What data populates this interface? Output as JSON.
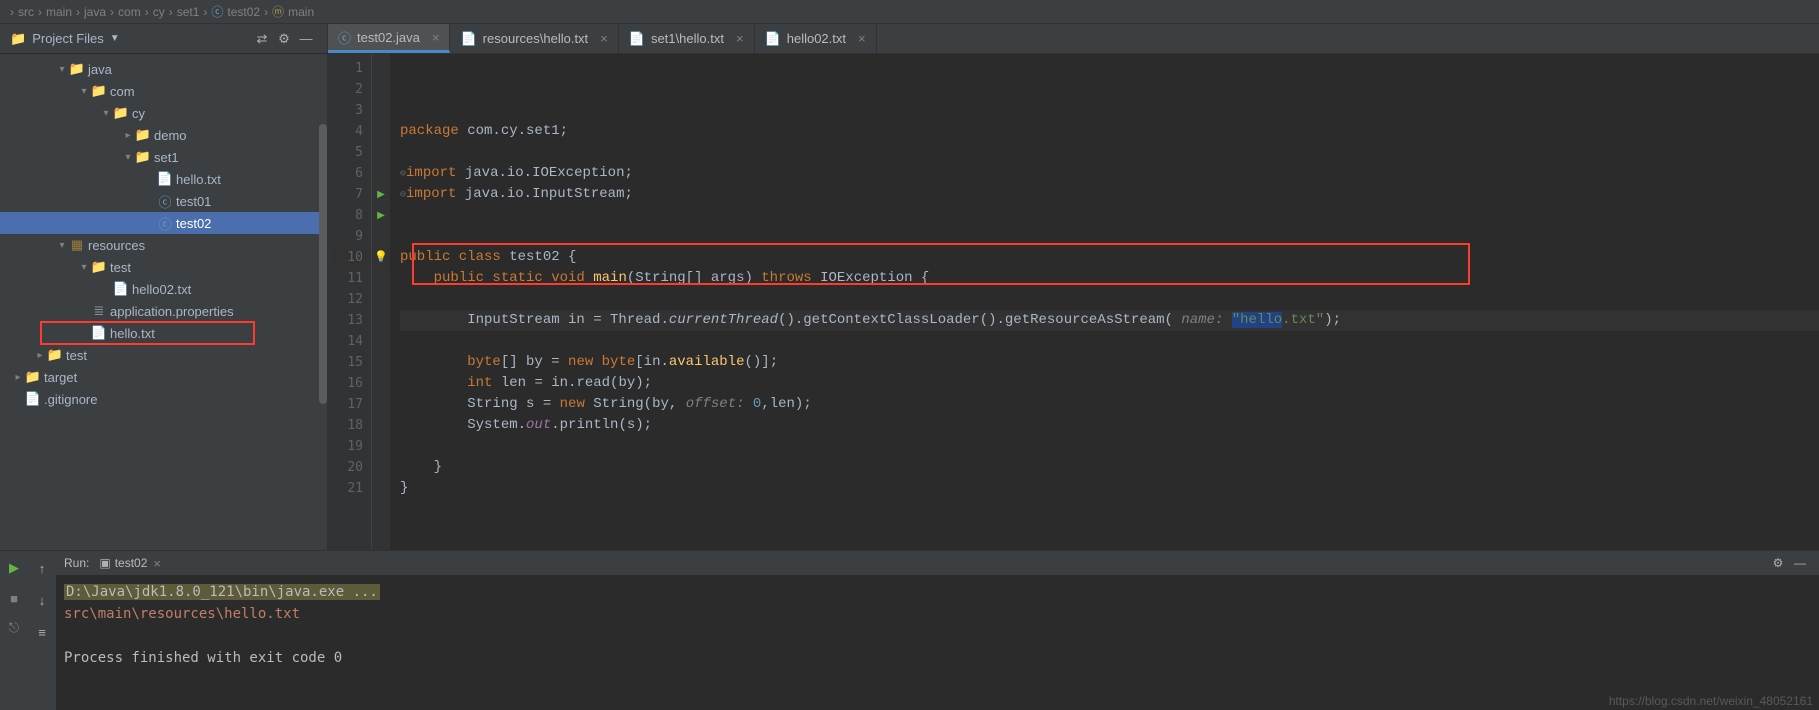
{
  "breadcrumb": [
    "src",
    "main",
    "java",
    "com",
    "cy",
    "set1",
    "test02",
    "main"
  ],
  "sidebar": {
    "title": "Project Files",
    "tree": [
      {
        "depth": 2,
        "arrow": "down",
        "icon": "folder",
        "label": "java",
        "cls": "folder-icon"
      },
      {
        "depth": 3,
        "arrow": "down",
        "icon": "folder",
        "label": "com",
        "cls": "folder-icon"
      },
      {
        "depth": 4,
        "arrow": "down",
        "icon": "folder",
        "label": "cy",
        "cls": "folder-icon"
      },
      {
        "depth": 5,
        "arrow": "right",
        "icon": "folder",
        "label": "demo",
        "cls": "folder-icon"
      },
      {
        "depth": 5,
        "arrow": "down",
        "icon": "folder",
        "label": "set1",
        "cls": "folder-icon"
      },
      {
        "depth": 6,
        "arrow": "",
        "icon": "file",
        "label": "hello.txt",
        "cls": "file-icon"
      },
      {
        "depth": 6,
        "arrow": "",
        "icon": "java",
        "label": "test01",
        "cls": "java-icon"
      },
      {
        "depth": 6,
        "arrow": "",
        "icon": "java",
        "label": "test02",
        "cls": "java-icon",
        "selected": true
      },
      {
        "depth": 2,
        "arrow": "down",
        "icon": "folder-res",
        "label": "resources",
        "cls": "folder-icon"
      },
      {
        "depth": 3,
        "arrow": "down",
        "icon": "folder",
        "label": "test",
        "cls": "folder-icon"
      },
      {
        "depth": 4,
        "arrow": "",
        "icon": "file",
        "label": "hello02.txt",
        "cls": "file-icon"
      },
      {
        "depth": 3,
        "arrow": "",
        "icon": "props",
        "label": "application.properties",
        "cls": "file-icon"
      },
      {
        "depth": 3,
        "arrow": "",
        "icon": "file",
        "label": "hello.txt",
        "cls": "file-icon",
        "boxed": true
      },
      {
        "depth": 1,
        "arrow": "right",
        "icon": "folder",
        "label": "test",
        "cls": "folder-icon"
      },
      {
        "depth": 0,
        "arrow": "right",
        "icon": "folder-t",
        "label": "target",
        "cls": "folder-icon"
      },
      {
        "depth": 0,
        "arrow": "",
        "icon": "file",
        "label": ".gitignore",
        "cls": "file-icon"
      }
    ]
  },
  "tabs": [
    {
      "icon": "java",
      "label": "test02.java",
      "active": true
    },
    {
      "icon": "file",
      "label": "resources\\hello.txt"
    },
    {
      "icon": "file",
      "label": "set1\\hello.txt"
    },
    {
      "icon": "file",
      "label": "hello02.txt"
    }
  ],
  "code": {
    "lines": [
      1,
      2,
      3,
      4,
      5,
      6,
      7,
      8,
      9,
      10,
      11,
      12,
      13,
      14,
      15,
      16,
      17,
      18,
      19,
      20,
      21
    ],
    "l1": "package com.cy.set1;",
    "l3": "import java.io.IOException;",
    "l4": "import java.io.InputStream;",
    "l7": "public class test02 {",
    "l8": "    public static void main(String[] args) throws IOException {",
    "l10a": "        InputStream in = Thread.currentThread().getContextClassLoader().getResourceAsStream(",
    "l10p": " name: ",
    "l10s": "\"hello.txt\"",
    "l10e": ");",
    "l12": "        byte[] by = new byte[in.available()];",
    "l13": "        int len = in.read(by);",
    "l14": "        String s = new String(by, ",
    "l14p": "offset: ",
    "l14n": "0",
    "l14e": ",len);",
    "l15": "        System.out.println(s);",
    "l17": "    }",
    "l18": "}"
  },
  "run": {
    "label": "Run:",
    "config": "test02",
    "cmdline": "D:\\Java\\jdk1.8.0_121\\bin\\java.exe ...",
    "out1": "src\\main\\resources\\hello.txt",
    "out2": "Process finished with exit code 0"
  },
  "watermark": "https://blog.csdn.net/weixin_48052161"
}
